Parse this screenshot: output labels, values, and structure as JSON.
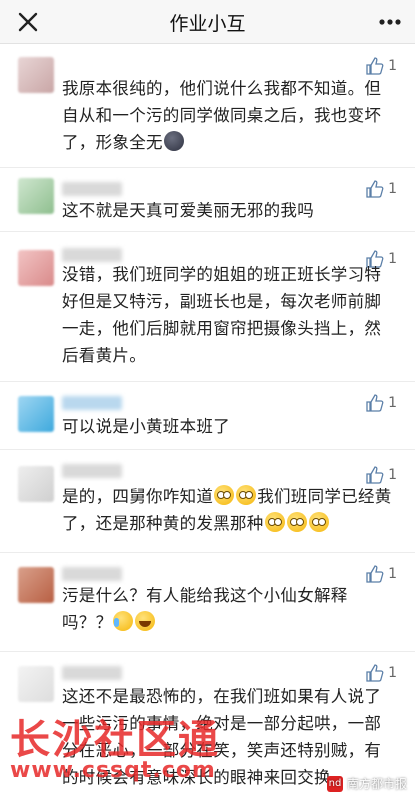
{
  "header": {
    "title": "作业小互"
  },
  "comments": [
    {
      "likes": "1",
      "text": "我原本很纯的，他们说什么我都不知道。但自从和一个污的同学做同桌之后，我也变坏了，形象全无"
    },
    {
      "likes": "1",
      "text": "这不就是天真可爱美丽无邪的我吗"
    },
    {
      "likes": "1",
      "text": "没错，我们班同学的姐姐的班正班长学习特好但是又特污，副班长也是，每次老师前脚一走，他们后脚就用窗帘把摄像头挡上，然后看黄片。"
    },
    {
      "likes": "1",
      "text": "可以说是小黄班本班了"
    },
    {
      "likes": "1",
      "text_a": "是的，四舅你咋知道",
      "text_b": "我们班同学已经黄了，还是那种黄的发黑那种"
    },
    {
      "likes": "1",
      "text": "污是什么？有人能给我这个小仙女解释吗？？"
    },
    {
      "likes": "1",
      "text": "这还不是最恐怖的，在我们班如果有人说了一些污污的事情，绝对是一部分起哄，一部分在恶心，一部分在笑，笑声还特别贼，有的时候会有意味深长的眼神来回交换。"
    }
  ],
  "watermark": {
    "big": "长沙社区通",
    "url": "www.cssqt.com",
    "source": "南方都市报"
  },
  "colors": {
    "accent_red": "#e62828",
    "text": "#222222",
    "meta": "#666666"
  }
}
